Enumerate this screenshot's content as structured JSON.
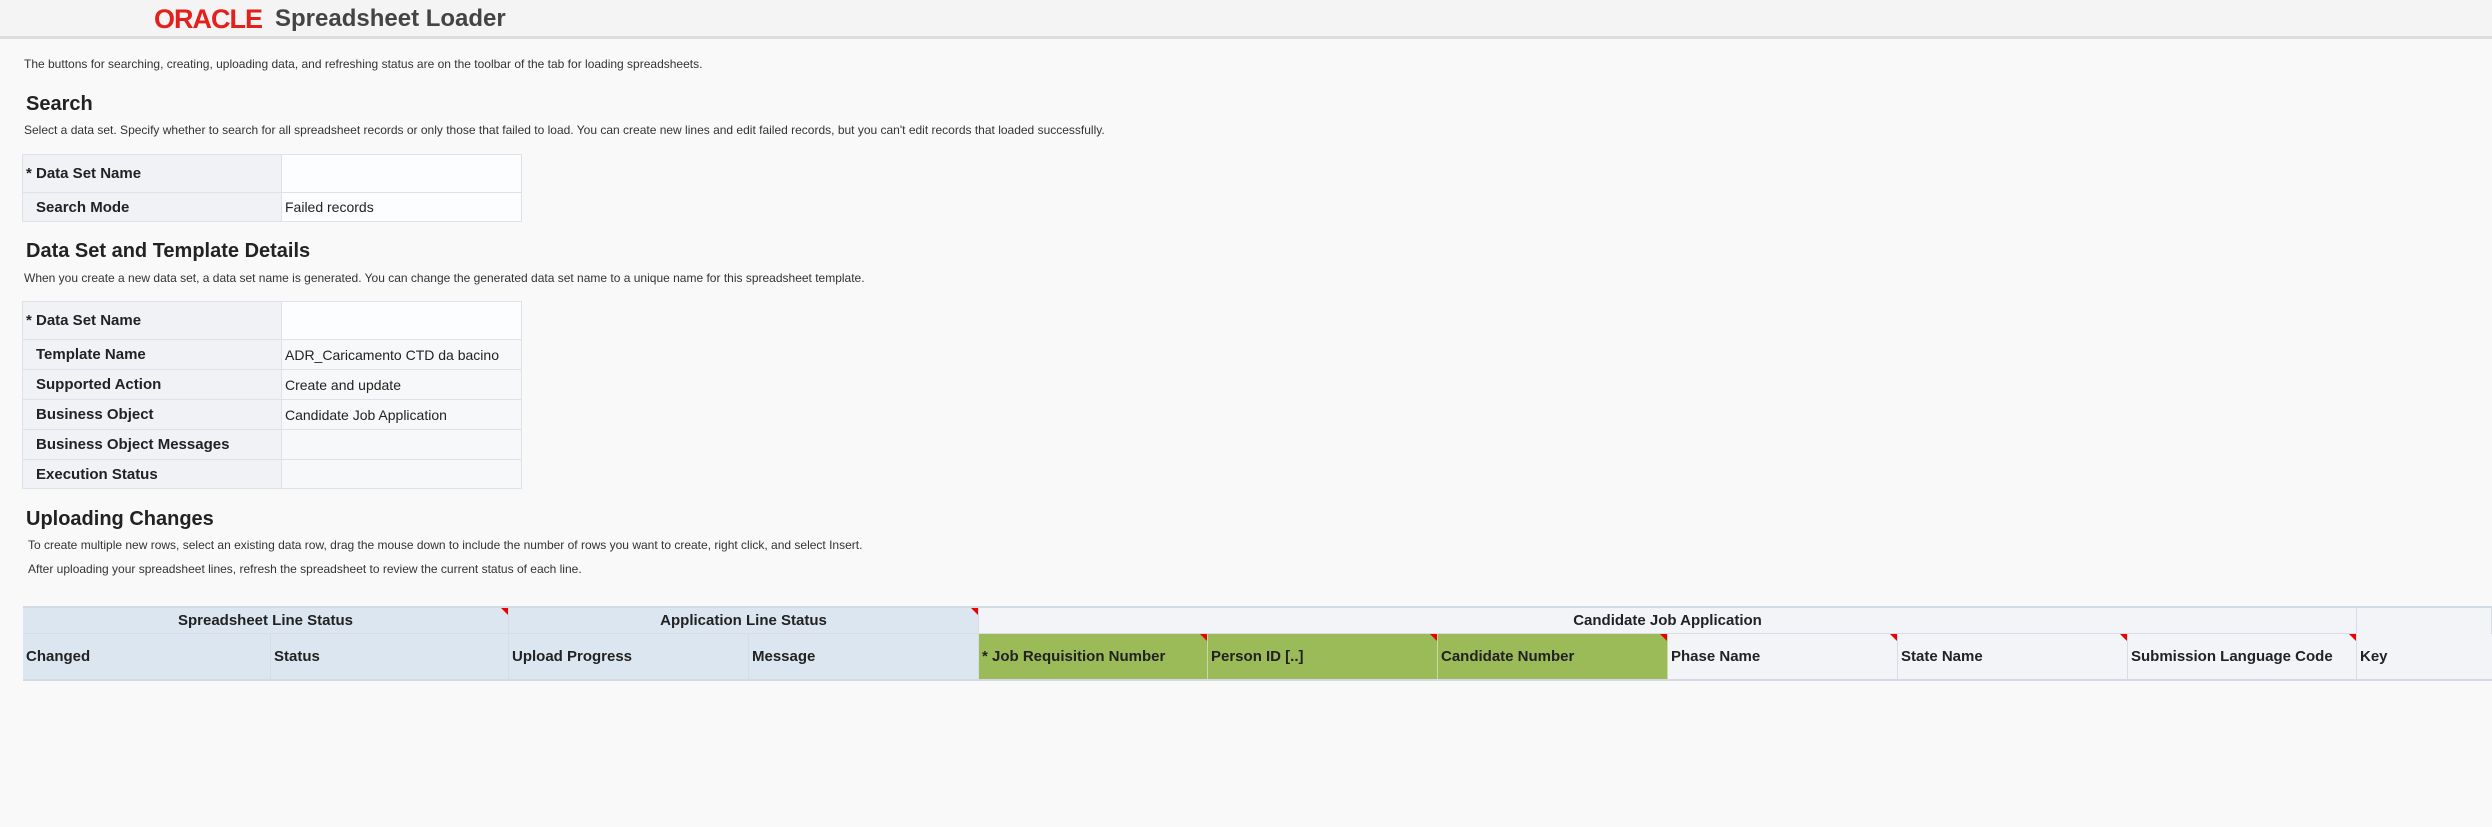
{
  "header": {
    "logo": "ORACLE",
    "title": "Spreadsheet Loader"
  },
  "intro": "The buttons for searching, creating, uploading data, and refreshing status are on the toolbar of the tab for loading spreadsheets.",
  "search": {
    "title": "Search",
    "description": "Select a data set. Specify whether to search for all spreadsheet records or only those that failed to load. You can create new lines and edit failed records, but you can't edit records that loaded successfully.",
    "fields": [
      {
        "label": "* Data Set Name",
        "value": ""
      },
      {
        "label": "Search Mode",
        "value": "Failed records"
      }
    ]
  },
  "details": {
    "title": "Data Set and Template Details",
    "description": "When you create a new data set, a data set name is generated. You can change the generated data set name to a unique name for this spreadsheet template.",
    "fields": [
      {
        "label": "* Data Set Name",
        "value": ""
      },
      {
        "label": "Template Name",
        "value": "ADR_Caricamento CTD da bacino"
      },
      {
        "label": "Supported Action",
        "value": "Create and update"
      },
      {
        "label": "Business Object",
        "value": "Candidate Job Application"
      },
      {
        "label": "Business Object Messages",
        "value": ""
      },
      {
        "label": "Execution Status",
        "value": ""
      }
    ]
  },
  "uploading": {
    "title": "Uploading Changes",
    "line1": "To create multiple new rows, select an existing data row, drag the mouse down to include the number of rows you want to create, right click, and select Insert.",
    "line2": "After uploading your spreadsheet lines, refresh the spreadsheet to review the current status of each line."
  },
  "grid": {
    "groups": [
      "Spreadsheet Line Status",
      "Application Line Status",
      "Candidate Job Application"
    ],
    "columns": [
      "Changed",
      "Status",
      "Upload Progress",
      "Message",
      "* Job Requisition Number",
      "Person ID [..]",
      "Candidate Number",
      "Phase Name",
      "State Name",
      "Submission Language Code",
      "Key"
    ]
  },
  "colors": {
    "required_column": "#9bbb59",
    "status_header": "#dce6f1",
    "oracle_red": "#e3201b"
  }
}
